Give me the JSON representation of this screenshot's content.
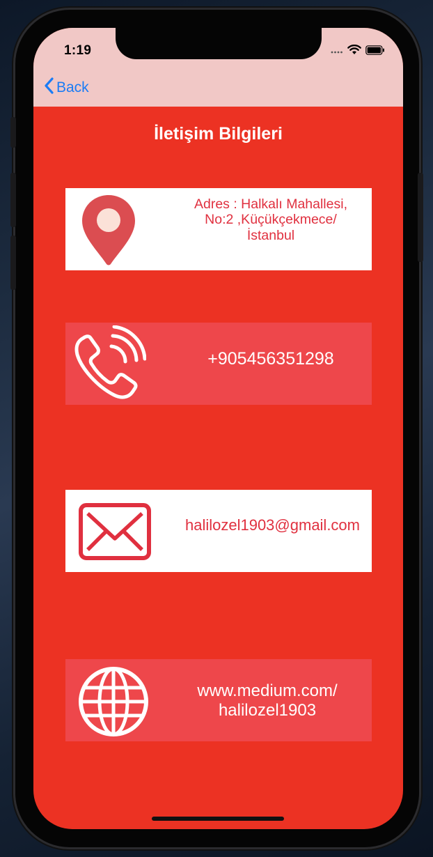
{
  "status_bar": {
    "time": "1:19"
  },
  "nav": {
    "back_label": "Back"
  },
  "page": {
    "title": "İletişim Bilgileri"
  },
  "contacts": {
    "address_lines": [
      "Adres : Halkalı Mahallesi,",
      "No:2 ,Küçükçekmece/",
      "İstanbul"
    ],
    "phone": "+905456351298",
    "email": "halilozel1903@gmail.com",
    "website_lines": [
      "www.medium.com/",
      "halilozel1903"
    ]
  },
  "colors": {
    "background": "#ec3223",
    "nav_bar": "#f1c8c6",
    "card_alt": "#ee474b",
    "accent_text": "#e0303f",
    "link": "#1a7cf5"
  },
  "icons": {
    "address": "location-pin-icon",
    "phone": "phone-icon",
    "email": "envelope-icon",
    "website": "globe-icon"
  }
}
